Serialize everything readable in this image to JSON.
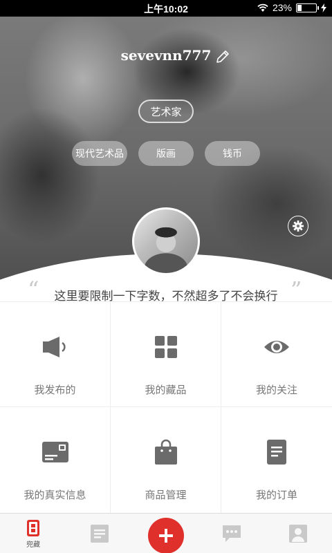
{
  "status_bar": {
    "time": "上午10:02",
    "battery_percent": "23%",
    "battery_level": 0.23
  },
  "profile": {
    "username": "sevevnn777",
    "role_tag": "艺术家",
    "interest_tags": [
      "现代艺术品",
      "版画",
      "钱币"
    ],
    "motto": "这里要限制一下字数，不然超多了不会换行",
    "quote_open": "“",
    "quote_close": "”"
  },
  "menu": {
    "items": [
      {
        "label": "我发布的",
        "icon": "megaphone-icon"
      },
      {
        "label": "我的藏品",
        "icon": "grid-icon"
      },
      {
        "label": "我的关注",
        "icon": "eye-icon"
      },
      {
        "label": "我的真实信息",
        "icon": "id-card-icon"
      },
      {
        "label": "商品管理",
        "icon": "shopping-bag-icon"
      },
      {
        "label": "我的订单",
        "icon": "document-icon"
      }
    ]
  },
  "bottom_nav": {
    "items": [
      {
        "label": "兜藏",
        "icon": "collection-icon",
        "active": true
      },
      {
        "label": "",
        "icon": "list-icon"
      },
      {
        "label": "",
        "icon": "plus-icon"
      },
      {
        "label": "",
        "icon": "chat-icon"
      },
      {
        "label": "",
        "icon": "user-icon"
      }
    ]
  },
  "colors": {
    "accent": "#e0302b",
    "icon_gray": "#6b6b6b",
    "label_gray": "#777777"
  }
}
